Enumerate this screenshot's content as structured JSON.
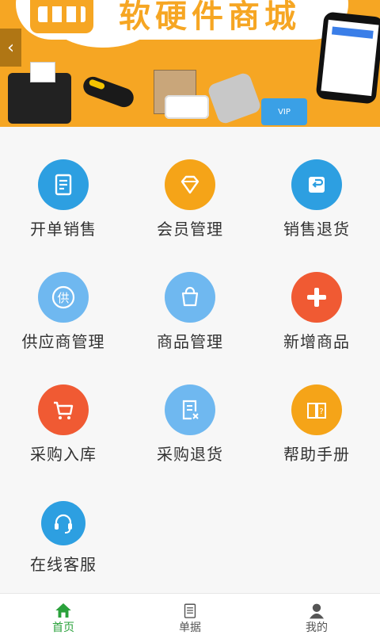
{
  "banner": {
    "title": "软硬件商城",
    "vip_text": "VIP"
  },
  "menu": [
    {
      "label": "开单销售",
      "icon": "note-edit-icon",
      "color": "#2d9fe1"
    },
    {
      "label": "会员管理",
      "icon": "diamond-icon",
      "color": "#f5a418"
    },
    {
      "label": "销售退货",
      "icon": "return-box-icon",
      "color": "#2d9fe1"
    },
    {
      "label": "供应商管理",
      "icon": "supplier-badge-icon",
      "color": "#6fb8f0"
    },
    {
      "label": "商品管理",
      "icon": "shopping-bag-icon",
      "color": "#6fb8f0"
    },
    {
      "label": "新增商品",
      "icon": "plus-icon",
      "color": "#f05a33"
    },
    {
      "label": "采购入库",
      "icon": "cart-icon",
      "color": "#f05a33"
    },
    {
      "label": "采购退货",
      "icon": "document-x-icon",
      "color": "#6fb8f0"
    },
    {
      "label": "帮助手册",
      "icon": "help-book-icon",
      "color": "#f5a418"
    },
    {
      "label": "在线客服",
      "icon": "headset-icon",
      "color": "#2d9fe1"
    }
  ],
  "tabbar": {
    "home_label": "首页",
    "orders_label": "单据",
    "profile_label": "我的",
    "active_color": "#2aa13b",
    "inactive_color": "#555555"
  }
}
